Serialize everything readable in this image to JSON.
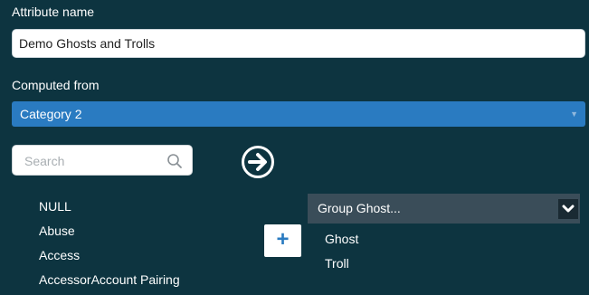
{
  "attribute": {
    "label": "Attribute name",
    "value": "Demo Ghosts and Trolls"
  },
  "computed_from": {
    "label": "Computed from",
    "selected": "Category 2"
  },
  "search": {
    "placeholder": "Search",
    "icon": "search-icon"
  },
  "go_button": {
    "icon": "arrow-right-circle-icon"
  },
  "values_list": [
    "NULL",
    "Abuse",
    "Access",
    "AccessorAccount Pairing"
  ],
  "add_button": {
    "label": "+"
  },
  "group": {
    "title": "Group Ghost...",
    "members": [
      "Ghost",
      "Troll"
    ]
  },
  "colors": {
    "background": "#0d3440",
    "accent": "#2a7bc1",
    "group_header": "#3a4d59"
  }
}
